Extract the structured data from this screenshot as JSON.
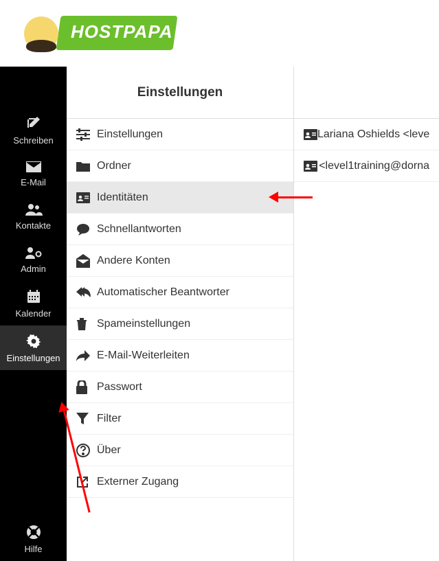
{
  "logo": {
    "text": "HOSTPAPA"
  },
  "sidebar": {
    "items": [
      {
        "label": "Schreiben",
        "name": "sidebar-compose"
      },
      {
        "label": "E-Mail",
        "name": "sidebar-email"
      },
      {
        "label": "Kontakte",
        "name": "sidebar-contacts"
      },
      {
        "label": "Admin",
        "name": "sidebar-admin"
      },
      {
        "label": "Kalender",
        "name": "sidebar-calendar"
      },
      {
        "label": "Einstellungen",
        "name": "sidebar-settings",
        "active": true
      }
    ],
    "help": {
      "label": "Hilfe",
      "name": "sidebar-help"
    }
  },
  "settings_panel": {
    "title": "Einstellungen",
    "items": [
      {
        "label": "Einstellungen",
        "name": "settings-preferences",
        "icon": "sliders"
      },
      {
        "label": "Ordner",
        "name": "settings-folders",
        "icon": "folder"
      },
      {
        "label": "Identitäten",
        "name": "settings-identities",
        "icon": "idcard",
        "selected": true
      },
      {
        "label": "Schnellantworten",
        "name": "settings-responses",
        "icon": "chat"
      },
      {
        "label": "Andere Konten",
        "name": "settings-other-accounts",
        "icon": "envelope-open"
      },
      {
        "label": "Automatischer Beantworter",
        "name": "settings-autoresponder",
        "icon": "reply-all"
      },
      {
        "label": "Spameinstellungen",
        "name": "settings-spam",
        "icon": "trash"
      },
      {
        "label": "E-Mail-Weiterleiten",
        "name": "settings-forwarding",
        "icon": "forward"
      },
      {
        "label": "Passwort",
        "name": "settings-password",
        "icon": "lock"
      },
      {
        "label": "Filter",
        "name": "settings-filter",
        "icon": "filter"
      },
      {
        "label": "Über",
        "name": "settings-about",
        "icon": "question"
      },
      {
        "label": "Externer Zugang",
        "name": "settings-external-access",
        "icon": "external"
      }
    ]
  },
  "identities_panel": {
    "items": [
      {
        "label": "Lariana Oshields <leve",
        "name": "identity-row-0"
      },
      {
        "label": "<level1training@dorna",
        "name": "identity-row-1"
      }
    ]
  }
}
